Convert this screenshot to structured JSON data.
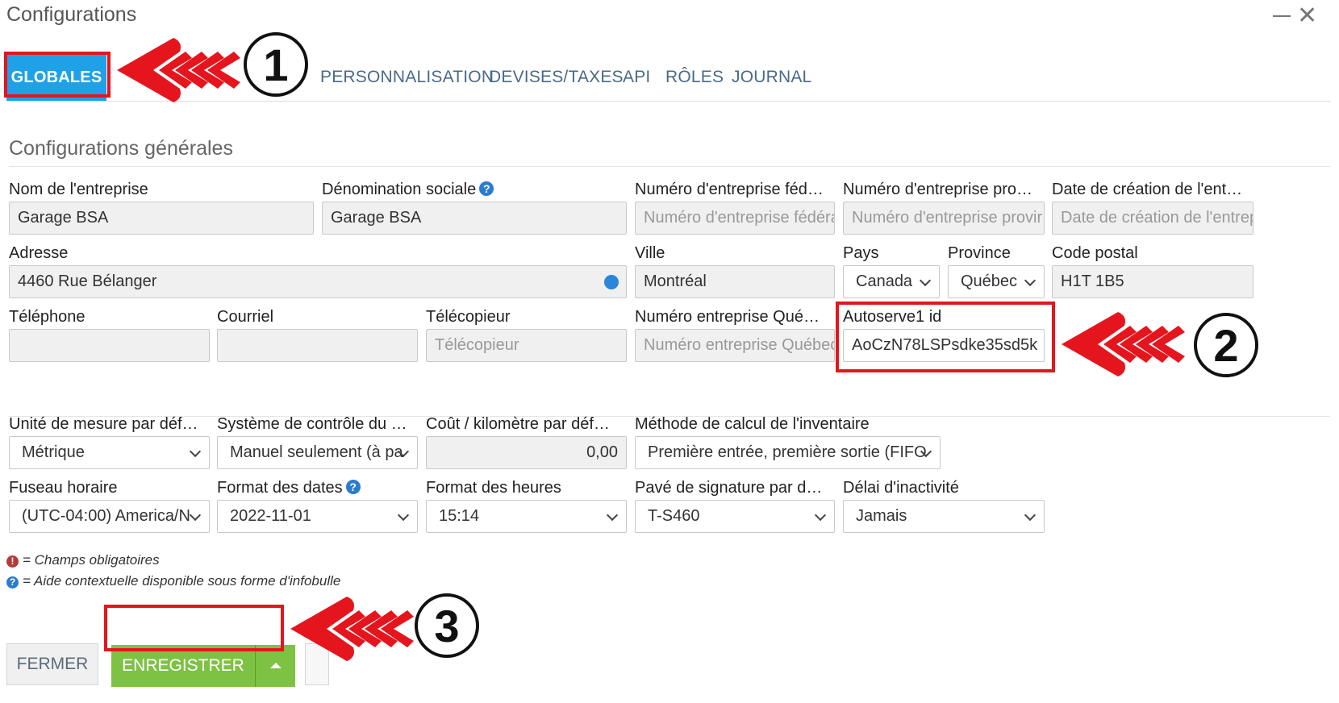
{
  "window": {
    "title": "Configurations"
  },
  "tabs": {
    "active": "GLOBALES",
    "items": [
      "PERSONNALISATION",
      "DEVISES/TAXES",
      "API",
      "RÔLES",
      "JOURNAL"
    ]
  },
  "section": {
    "title": "Configurations générales"
  },
  "fields": {
    "nom_entreprise": {
      "label": "Nom de l'entreprise",
      "value": "Garage BSA"
    },
    "denomination_sociale": {
      "label": "Dénomination sociale",
      "value": "Garage BSA"
    },
    "num_federal": {
      "label": "Numéro d'entreprise féd…",
      "placeholder": "Numéro d'entreprise fédéra"
    },
    "num_provincial": {
      "label": "Numéro d'entreprise pro…",
      "placeholder": "Numéro d'entreprise provir"
    },
    "date_creation": {
      "label": "Date de création de l'ent…",
      "placeholder": "Date de création de l'entrep"
    },
    "adresse": {
      "label": "Adresse",
      "value": "4460 Rue Bélanger"
    },
    "ville": {
      "label": "Ville",
      "value": "Montréal"
    },
    "pays": {
      "label": "Pays",
      "value": "Canada"
    },
    "province": {
      "label": "Province",
      "value": "Québec"
    },
    "code_postal": {
      "label": "Code postal",
      "value": "H1T 1B5"
    },
    "telephone": {
      "label": "Téléphone",
      "value": ""
    },
    "courriel": {
      "label": "Courriel",
      "value": ""
    },
    "telecopieur": {
      "label": "Télécopieur",
      "placeholder": "Télécopieur"
    },
    "num_quebec": {
      "label": "Numéro entreprise Qué…",
      "placeholder": "Numéro entreprise Québec"
    },
    "autoserve_id": {
      "label": "Autoserve1 id",
      "value": "AoCzN78LSPsdke35sd5k"
    },
    "unite_mesure": {
      "label": "Unité de mesure par déf…",
      "value": "Métrique"
    },
    "systeme_controle": {
      "label": "Système de contrôle du …",
      "value": "Manuel seulement (à pa"
    },
    "cout_km": {
      "label": "Coût / kilomètre par déf…",
      "value": "0,00"
    },
    "methode_inventaire": {
      "label": "Méthode de calcul de l'inventaire",
      "value": "Première entrée, première sortie (FIFO"
    },
    "fuseau": {
      "label": "Fuseau horaire",
      "value": "(UTC-04:00) America/N"
    },
    "format_dates": {
      "label": "Format des dates",
      "value": "2022-11-01"
    },
    "format_heures": {
      "label": "Format des heures",
      "value": "15:14"
    },
    "pave_signature": {
      "label": "Pavé de signature par d…",
      "value": "T-S460"
    },
    "delai_inactivite": {
      "label": "Délai d'inactivité",
      "value": "Jamais"
    }
  },
  "legend": {
    "required": "= Champs obligatoires",
    "help": "= Aide contextuelle disponible sous forme d'infobulle"
  },
  "buttons": {
    "close": "FERMER",
    "save": "ENREGISTRER"
  },
  "annotations": {
    "step1": "1",
    "step2": "2",
    "step3": "3"
  },
  "colors": {
    "accent": "#1ea1e6",
    "save_green": "#7dc243",
    "highlight_red": "#e5151e"
  }
}
